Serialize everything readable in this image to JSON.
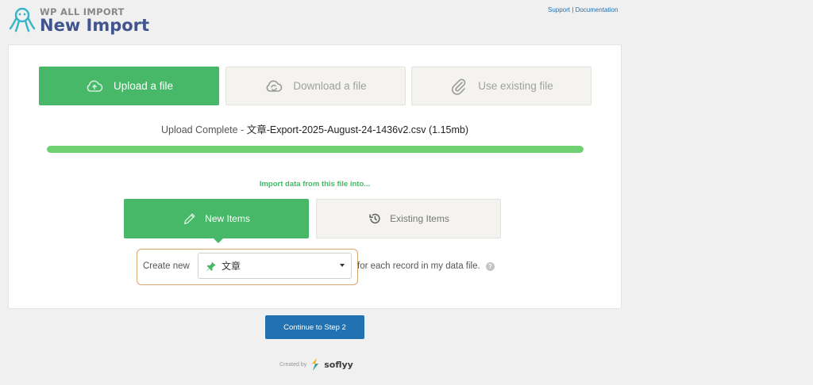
{
  "header": {
    "brand_small": "WP ALL IMPORT",
    "title": "New Import",
    "logo_icon": "octopus-logo-icon"
  },
  "top_links": {
    "support": "Support",
    "separator": "|",
    "documentation": "Documentation"
  },
  "source_tabs": [
    {
      "label": "Upload a file",
      "icon": "cloud-upload-icon",
      "active": true
    },
    {
      "label": "Download a file",
      "icon": "cloud-download-icon",
      "active": false
    },
    {
      "label": "Use existing file",
      "icon": "paperclip-icon",
      "active": false
    }
  ],
  "upload": {
    "status": "Upload Complete",
    "dash": " - ",
    "filename": "文章-Export-2025-August-24-1436v2.csv (1.15mb)",
    "progress": 1.0
  },
  "import_into": "Import data from this file into...",
  "item_tabs": [
    {
      "label": "New Items",
      "icon": "pencil-icon",
      "active": true
    },
    {
      "label": "Existing Items",
      "icon": "history-icon",
      "active": false
    }
  ],
  "create": {
    "prefix": "Create new",
    "selected": "文章",
    "selected_icon": "pin-icon",
    "suffix": "for each record in my data file.",
    "help": "?"
  },
  "continue_label": "Continue to Step 2",
  "footer": {
    "created_by": "Created by",
    "company": "soflyy"
  },
  "colors": {
    "accent_green": "#46b868",
    "progress_green": "#6fd072",
    "button_blue": "#2271b1",
    "title_blue": "#40558f"
  }
}
